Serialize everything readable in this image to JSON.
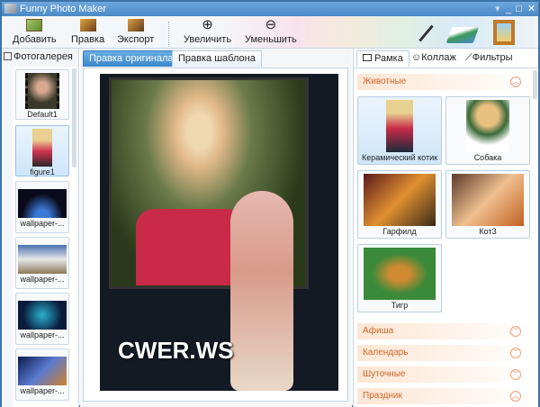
{
  "window": {
    "title": "Funny Photo Maker",
    "controls": [
      "▾",
      "_",
      "□",
      "✕"
    ]
  },
  "toolbar": {
    "add": "Добавить",
    "edit": "Правка",
    "export": "Экспорт",
    "zoom_in": "Увеличить",
    "zoom_out": "Уменьшить"
  },
  "gallery": {
    "title": "Фотогалерея",
    "items": [
      {
        "label": "Default1"
      },
      {
        "label": "figure1",
        "selected": true
      },
      {
        "label": "wallpaper-..."
      },
      {
        "label": "wallpaper-..."
      },
      {
        "label": "wallpaper-..."
      },
      {
        "label": "wallpaper-..."
      }
    ]
  },
  "editor": {
    "tabs": [
      {
        "label": "Правка оригинала",
        "active": true
      },
      {
        "label": "Правка шаблона"
      }
    ],
    "watermark": "CWER.WS"
  },
  "templates": {
    "tabs": [
      {
        "label": "Рамка",
        "active": true
      },
      {
        "label": "Коллаж"
      },
      {
        "label": "Фильтры"
      }
    ],
    "open_category": "Животные",
    "items": [
      {
        "label": "Керамический котик",
        "selected": true
      },
      {
        "label": "Собака"
      },
      {
        "label": "Гарфилд"
      },
      {
        "label": "Кот3"
      },
      {
        "label": "Тигр"
      }
    ],
    "categories": [
      "Афиша",
      "Календарь",
      "Шуточные",
      "Праздник"
    ]
  },
  "colors": {
    "accent": "#3d74a8",
    "category_text": "#d2662a",
    "active_tab": "#4a90d0"
  }
}
